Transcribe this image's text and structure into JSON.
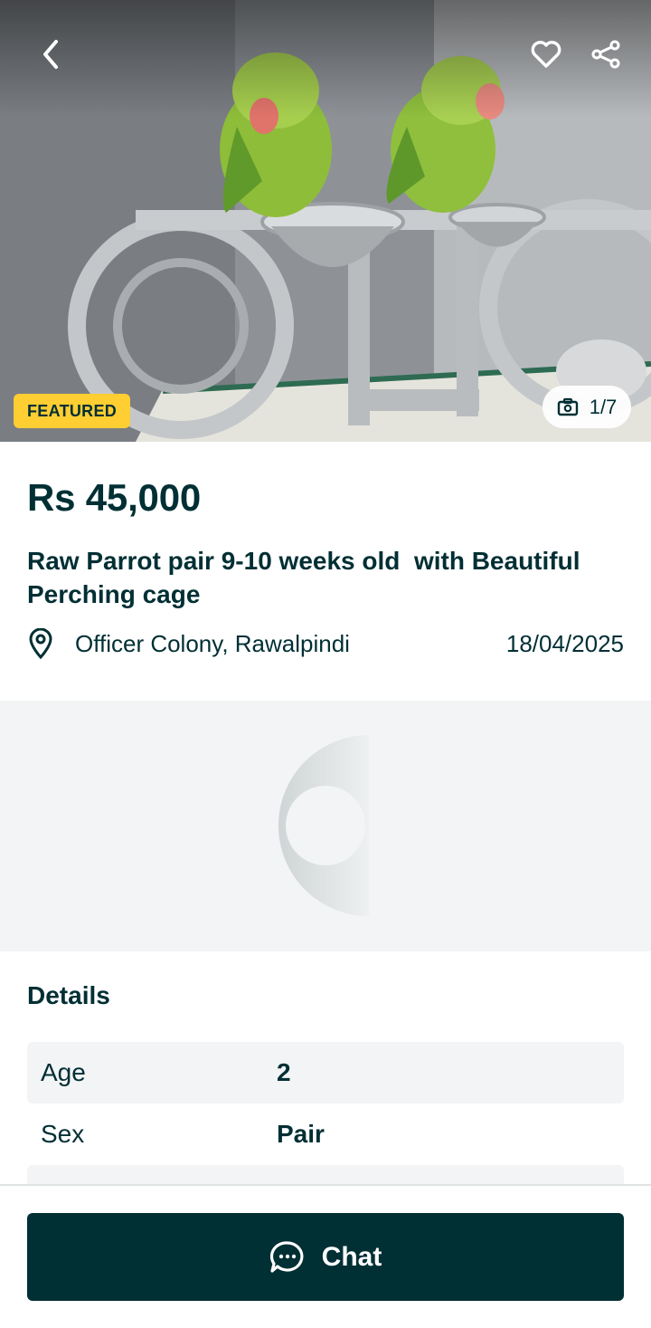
{
  "hero": {
    "featured_label": "FEATURED",
    "photo_counter": "1/7",
    "icons": {
      "back": "chevron-left-icon",
      "favorite": "heart-icon",
      "share": "share-icon",
      "camera": "camera-icon"
    }
  },
  "listing": {
    "price": "Rs 45,000",
    "title": "Raw Parrot pair 9-10 weeks old  with Beautiful Perching cage",
    "location": "Officer Colony, Rawalpindi",
    "date": "18/04/2025"
  },
  "details": {
    "heading": "Details",
    "rows": [
      {
        "label": "Age",
        "value": "2"
      },
      {
        "label": "Sex",
        "value": "Pair"
      }
    ]
  },
  "bottom": {
    "chat_label": "Chat",
    "chat_icon": "chat-bubble-icon"
  },
  "colors": {
    "brand_dark": "#002f34",
    "featured_yellow": "#ffce32",
    "panel_gray": "#f2f4f5"
  }
}
